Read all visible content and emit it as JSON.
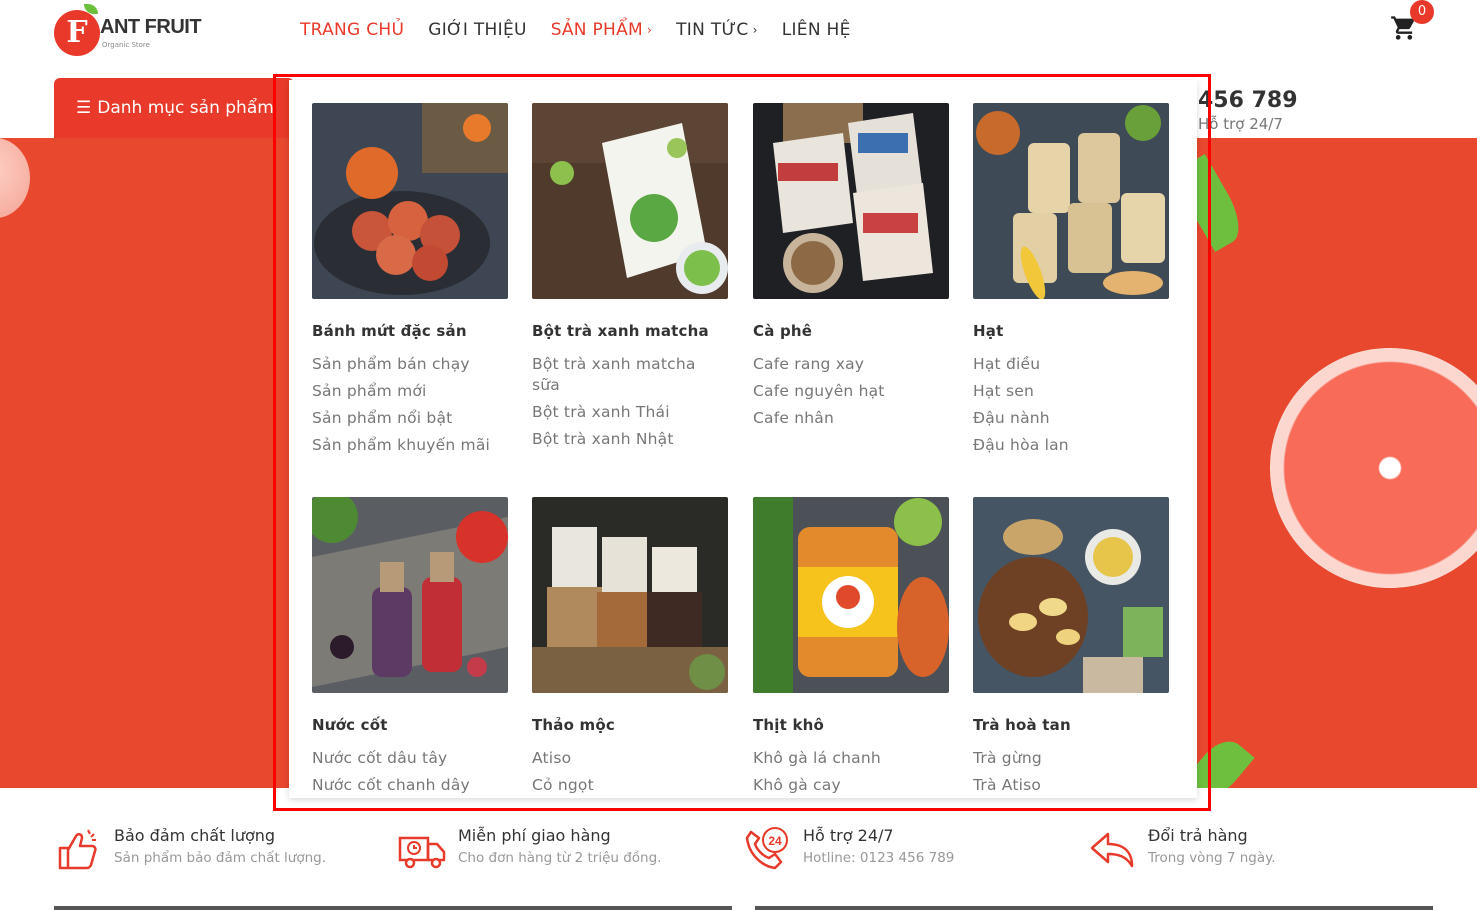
{
  "brand": {
    "name": "ANT FRUIT",
    "sub": "Organic Store",
    "mark": "F"
  },
  "nav": [
    {
      "label": "TRANG CHỦ",
      "chevron": ""
    },
    {
      "label": "GIỚI THIỆU",
      "chevron": ""
    },
    {
      "label": "SẢN PHẨM",
      "chevron": "›"
    },
    {
      "label": "TIN TỨC",
      "chevron": "›"
    },
    {
      "label": "LIÊN HỆ",
      "chevron": ""
    }
  ],
  "cart": {
    "count": "0",
    "icon": "cart-icon"
  },
  "category_button": {
    "label": "Danh mục sản phẩm",
    "icon": "list-icon"
  },
  "hotline": {
    "number": "456 789",
    "sub": "Hỗ trợ 24/7"
  },
  "colors": {
    "accent": "#e8392a",
    "banner": "#e8482e",
    "highlight": "#ff0000"
  },
  "mega_menu": [
    {
      "title": "Bánh mứt đặc sản",
      "links": [
        "Sản phẩm bán chạy",
        "Sản phẩm mới",
        "Sản phẩm nổi bật",
        "Sản phẩm khuyến mãi"
      ]
    },
    {
      "title": "Bột trà xanh matcha",
      "links": [
        "Bột trà xanh matcha sữa",
        "Bột trà xanh Thái",
        "Bột trà xanh Nhật"
      ]
    },
    {
      "title": "Cà phê",
      "links": [
        "Cafe rang xay",
        "Cafe nguyên hạt",
        "Cafe nhân"
      ]
    },
    {
      "title": "Hạt",
      "links": [
        "Hạt điều",
        "Hạt sen",
        "Đậu nành",
        "Đậu hòa lan"
      ]
    },
    {
      "title": "Nước cốt",
      "links": [
        "Nước cốt dâu tây",
        "Nước cốt chanh dây"
      ]
    },
    {
      "title": "Thảo mộc",
      "links": [
        "Atiso",
        "Cỏ ngọt"
      ]
    },
    {
      "title": "Thịt khô",
      "links": [
        "Khô gà lá chanh",
        "Khô gà cay"
      ]
    },
    {
      "title": "Trà hoà tan",
      "links": [
        "Trà gừng",
        "Trà Atiso"
      ]
    }
  ],
  "features": [
    {
      "title": "Bảo đảm chất lượng",
      "sub": "Sản phẩm bảo đảm chất lượng.",
      "icon": "thumbs-up-icon"
    },
    {
      "title": "Miễn phí giao hàng",
      "sub": "Cho đơn hàng từ 2 triệu đồng.",
      "icon": "truck-icon"
    },
    {
      "title": "Hỗ trợ 24/7",
      "sub": "Hotline: 0123 456 789",
      "icon": "phone-24-icon"
    },
    {
      "title": "Đổi trả hàng",
      "sub": "Trong vòng 7 ngày.",
      "icon": "return-arrow-icon"
    }
  ]
}
